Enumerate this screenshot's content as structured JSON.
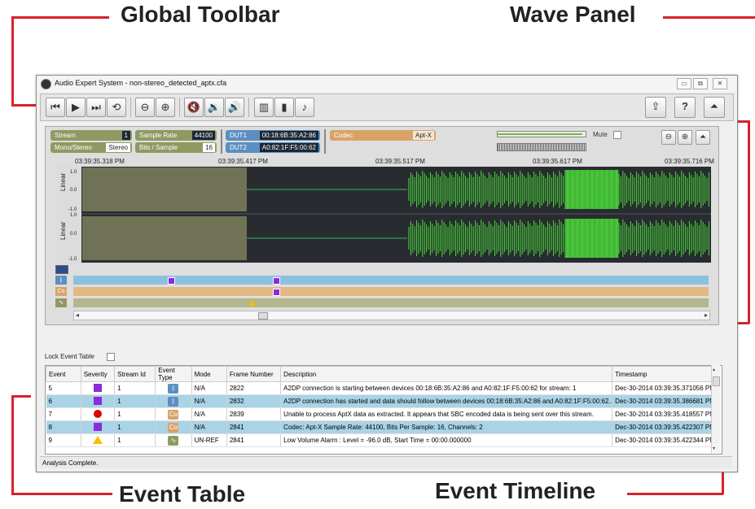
{
  "callouts": {
    "global_toolbar": "Global Toolbar",
    "wave_panel": "Wave Panel",
    "event_table": "Event Table",
    "event_timeline": "Event Timeline"
  },
  "window": {
    "title": "Audio Expert System - non-stereo_detected_aptx.cfa",
    "controls": [
      "▭",
      "⧉",
      "✕"
    ]
  },
  "toolbar": {
    "buttons": [
      {
        "name": "skip-start-button",
        "glyph": "⏮"
      },
      {
        "name": "play-button",
        "glyph": "▶"
      },
      {
        "name": "skip-end-button",
        "glyph": "⏭"
      },
      {
        "name": "loop-button",
        "glyph": "⟲"
      },
      {
        "name": "zoom-out-button",
        "glyph": "⊖"
      },
      {
        "name": "zoom-in-button",
        "glyph": "⊕"
      },
      {
        "name": "mute-button",
        "glyph": "🔇"
      },
      {
        "name": "volume-down-button",
        "glyph": "🔉"
      },
      {
        "name": "volume-up-button",
        "glyph": "🔊"
      },
      {
        "name": "spectrum-button",
        "glyph": "▥"
      },
      {
        "name": "levels-button",
        "glyph": "▮"
      },
      {
        "name": "notes-button",
        "glyph": "♪"
      }
    ],
    "right_buttons": [
      {
        "name": "export-button",
        "glyph": "⇪"
      },
      {
        "name": "help-button",
        "glyph": "?"
      },
      {
        "name": "collapse-button",
        "glyph": "⏶"
      }
    ]
  },
  "wave": {
    "stream_label": "Stream",
    "stream_value": "1",
    "mono_stereo_label": "Mono/Stereo",
    "mono_stereo_value": "Stereo",
    "sample_rate_label": "Sample Rate",
    "sample_rate_value": "44100",
    "bits_label": "Bits / Sample",
    "bits_value": "16",
    "dut1_label": "DUT1",
    "dut1_value": "00:18:6B:35:A2:86",
    "dut2_label": "DUT2",
    "dut2_value": "A0:82:1F:F5:00:62",
    "codec_label": "Codec",
    "codec_value": "Apt-X",
    "mute_label": "Mute",
    "timestamps": [
      "03:39:35.318 PM",
      "03:39:35.417 PM",
      "03:39:35.517 PM",
      "03:39:35.617 PM",
      "03:39:35.716 PM"
    ],
    "axis_label": "Linear",
    "ticks_top": [
      "1.0",
      "0.0",
      "-1.0"
    ],
    "ticks_bottom": [
      "1.0",
      "0.0",
      "-1.0"
    ]
  },
  "event_table": {
    "lock_label": "Lock Event Table",
    "columns": [
      "Event",
      "Severity",
      "Stream Id",
      "Event Type",
      "Mode",
      "Frame Number",
      "Description",
      "Timestamp"
    ],
    "rows": [
      {
        "event": "5",
        "severity": "purple-square",
        "stream": "1",
        "type": "bluetooth-icon",
        "mode": "N/A",
        "frame": "2822",
        "desc": "A2DP connection is starting between devices 00:18:6B:35:A2:86 and A0:82:1F:F5:00:62 for stream: 1",
        "ts": "Dec-30-2014 03:39:35.371056 PM",
        "selected": false
      },
      {
        "event": "6",
        "severity": "purple-square",
        "stream": "1",
        "type": "bluetooth-icon",
        "mode": "N/A",
        "frame": "2832",
        "desc": "A2DP connection has started and data should follow between devices 00:18:6B:35:A2:86 and A0:82:1F:F5:00:62...",
        "ts": "Dec-30-2014 03:39:35.386681 PM",
        "selected": true
      },
      {
        "event": "7",
        "severity": "red-circle",
        "stream": "1",
        "type": "codec-icon",
        "mode": "N/A",
        "frame": "2839",
        "desc": "Unable to process AptX data as extracted. It appears that SBC encoded data is being sent over this stream.",
        "ts": "Dec-30-2014 03:39:35.418557 PM",
        "selected": false
      },
      {
        "event": "8",
        "severity": "purple-square",
        "stream": "1",
        "type": "codec-icon",
        "mode": "N/A",
        "frame": "2841",
        "desc": "Codec: Apt-X  Sample Rate: 44100, Bits Per Sample: 16, Channels: 2",
        "ts": "Dec-30-2014 03:39:35.422307 PM",
        "selected": true
      },
      {
        "event": "9",
        "severity": "yellow-triangle",
        "stream": "1",
        "type": "audio-icon",
        "mode": "UN-REF",
        "frame": "2841",
        "desc": "Low Volume Alarm : Level = -96.0 dB, Start Time = 00:00.000000",
        "ts": "Dec-30-2014 03:39:35.422344 PM",
        "selected": false
      }
    ]
  },
  "status": "Analysis Complete.",
  "colors": {
    "callout_line": "#d8222b",
    "selected_row": "#a9d3e6",
    "timeline_blue": "#8cc0e0",
    "timeline_orange": "#e3b883",
    "timeline_olive": "#b5b58e"
  }
}
